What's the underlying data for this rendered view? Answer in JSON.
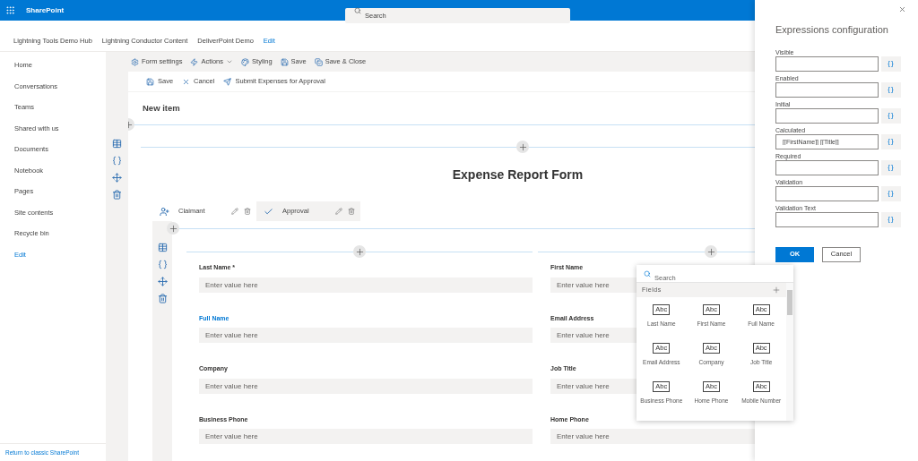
{
  "top_bar": {
    "app_name": "SharePoint",
    "search": {
      "placeholder": "Search"
    }
  },
  "hub_nav": [
    {
      "label": "Lightning Tools Demo Hub",
      "kind": "item"
    },
    {
      "label": "Lightning Conductor Content",
      "kind": "item"
    },
    {
      "label": "DeliverPoint Demo",
      "kind": "item"
    },
    {
      "label": "Edit",
      "kind": "link"
    }
  ],
  "sidebar": {
    "items": [
      {
        "label": "Home",
        "kind": "item"
      },
      {
        "label": "Conversations",
        "kind": "item"
      },
      {
        "label": "Teams",
        "kind": "item"
      },
      {
        "label": "Shared with us",
        "kind": "item"
      },
      {
        "label": "Documents",
        "kind": "item"
      },
      {
        "label": "Notebook",
        "kind": "item"
      },
      {
        "label": "Pages",
        "kind": "item"
      },
      {
        "label": "Site contents",
        "kind": "item"
      },
      {
        "label": "Recycle bin",
        "kind": "item"
      },
      {
        "label": "Edit",
        "kind": "link"
      }
    ],
    "footer_link": "Return to classic SharePoint"
  },
  "toolbar": [
    {
      "label": "Form settings",
      "dropdown": false
    },
    {
      "label": "Actions",
      "dropdown": true
    },
    {
      "label": "Styling",
      "dropdown": false
    },
    {
      "label": "Save",
      "dropdown": false
    },
    {
      "label": "Save & Close",
      "dropdown": false
    }
  ],
  "commands": [
    "Save",
    "Cancel",
    "Submit Expenses for Approval"
  ],
  "page_title": "New item",
  "form_title": "Expense Report Form",
  "tabs": [
    {
      "label": "Claimant",
      "selected": true
    },
    {
      "label": "Approval",
      "selected": false
    }
  ],
  "fields": [
    {
      "label": "Last Name *",
      "placeholder": "Enter value here",
      "selected": false
    },
    {
      "label": "First Name",
      "placeholder": "Enter value here",
      "selected": false
    },
    {
      "label": "Full Name",
      "placeholder": "Enter value here",
      "selected": true
    },
    {
      "label": "Email Address",
      "placeholder": "Enter value here",
      "selected": false
    },
    {
      "label": "Company",
      "placeholder": "Enter value here",
      "selected": false
    },
    {
      "label": "Job Title",
      "placeholder": "Enter value here",
      "selected": false
    },
    {
      "label": "Business Phone",
      "placeholder": "Enter value here",
      "selected": false
    },
    {
      "label": "Home Phone",
      "placeholder": "Enter value here",
      "selected": false
    }
  ],
  "field_picker": {
    "search": {
      "placeholder": "Search"
    },
    "header": "Fields",
    "items": [
      {
        "badge": "Abc",
        "label": "Last Name"
      },
      {
        "badge": "Abc",
        "label": "First Name"
      },
      {
        "badge": "Abc",
        "label": "Full Name"
      },
      {
        "badge": "Abc",
        "label": "Email Address"
      },
      {
        "badge": "Abc",
        "label": "Company"
      },
      {
        "badge": "Abc",
        "label": "Job Title"
      },
      {
        "badge": "Abc",
        "label": "Business Phone"
      },
      {
        "badge": "Abc",
        "label": "Home Phone"
      },
      {
        "badge": "Abc",
        "label": "Mobile Number"
      }
    ]
  },
  "expressions_panel": {
    "title": "Expressions configuration",
    "rows": [
      {
        "label": "Visible",
        "button": "{}"
      },
      {
        "label": "Enabled",
        "button": "{}"
      },
      {
        "label": "Initial",
        "button": "{}"
      },
      {
        "label": "Calculated",
        "value": "[[FirstName]] [[Title]]",
        "button": "{}"
      },
      {
        "label": "Required",
        "button": "{}"
      },
      {
        "label": "Validation",
        "button": "{}"
      },
      {
        "label": "Validation Text",
        "button": "{}"
      }
    ],
    "buttons": [
      {
        "label": "OK",
        "kind": "primary"
      },
      {
        "label": "Cancel",
        "kind": "default"
      }
    ]
  }
}
